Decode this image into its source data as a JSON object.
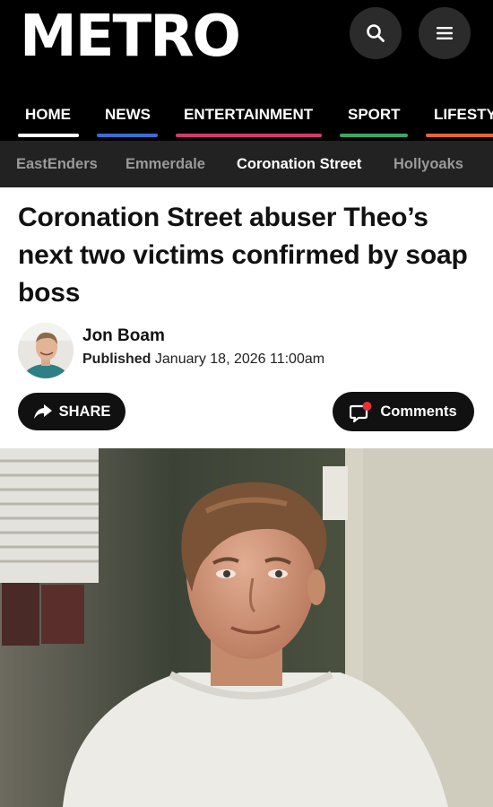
{
  "brand": {
    "logo_text": "METRO"
  },
  "header": {
    "search_icon": "search-icon",
    "menu_icon": "hamburger-menu-icon"
  },
  "main_nav": [
    {
      "label": "HOME",
      "color": "#ffffff"
    },
    {
      "label": "NEWS",
      "color": "#3a6fd8"
    },
    {
      "label": "ENTERTAINMENT",
      "color": "#d63a6c"
    },
    {
      "label": "SPORT",
      "color": "#3aa86a"
    },
    {
      "label": "LIFESTY",
      "color": "#e8643a"
    }
  ],
  "sub_nav": [
    {
      "label": "EastEnders",
      "active": false
    },
    {
      "label": "Emmerdale",
      "active": false
    },
    {
      "label": "Coronation Street",
      "active": true
    },
    {
      "label": "Hollyoaks",
      "active": false
    }
  ],
  "article": {
    "headline": "Coronation Street abuser Theo’s next two victims confirmed by soap boss",
    "author": "Jon Boam",
    "published_label": "Published",
    "published_date": "January 18, 2026 11:00am",
    "share_label": "SHARE",
    "comments_label": "Comments"
  },
  "colors": {
    "header_bg": "#000000",
    "subnav_bg": "#222222",
    "comments_dot": "#e8303a"
  }
}
